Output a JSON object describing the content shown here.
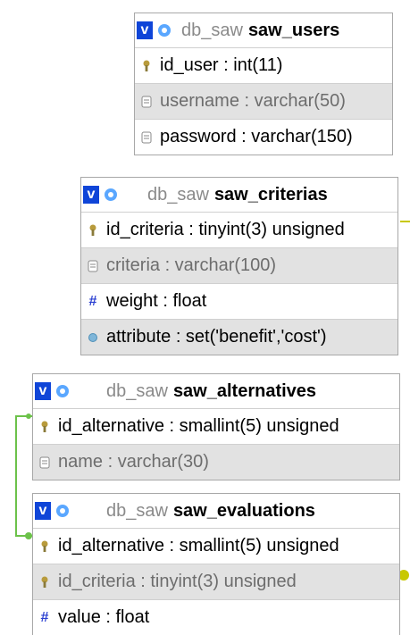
{
  "tables": [
    {
      "db": "db_saw",
      "name": "saw_users",
      "rows": [
        {
          "text": "id_user : int(11)",
          "icon": "key-icon"
        },
        {
          "text": "username : varchar(50)",
          "icon": "text-field-icon"
        },
        {
          "text": "password : varchar(150)",
          "icon": "text-field-icon"
        }
      ]
    },
    {
      "db": "db_saw",
      "name": "saw_criterias",
      "rows": [
        {
          "text": "id_criteria : tinyint(3) unsigned",
          "icon": "key-icon"
        },
        {
          "text": "criteria : varchar(100)",
          "icon": "text-field-icon"
        },
        {
          "text": "weight : float",
          "icon": "numeric-field-icon"
        },
        {
          "text": "attribute : set('benefit','cost')",
          "icon": "set-field-icon"
        }
      ]
    },
    {
      "db": "db_saw",
      "name": "saw_alternatives",
      "rows": [
        {
          "text": "id_alternative : smallint(5) unsigned",
          "icon": "key-icon"
        },
        {
          "text": "name : varchar(30)",
          "icon": "text-field-icon"
        }
      ]
    },
    {
      "db": "db_saw",
      "name": "saw_evaluations",
      "rows": [
        {
          "text": "id_alternative : smallint(5) unsigned",
          "icon": "key-icon"
        },
        {
          "text": "id_criteria : tinyint(3) unsigned",
          "icon": "key-icon"
        },
        {
          "text": "value : float",
          "icon": "numeric-field-icon"
        }
      ]
    }
  ],
  "header_buttons": {
    "toggle": "v"
  },
  "colors": {
    "relation_line": "#6cc24a",
    "relation_line_2": "#c8c800",
    "header_button": "#0f45d8"
  }
}
